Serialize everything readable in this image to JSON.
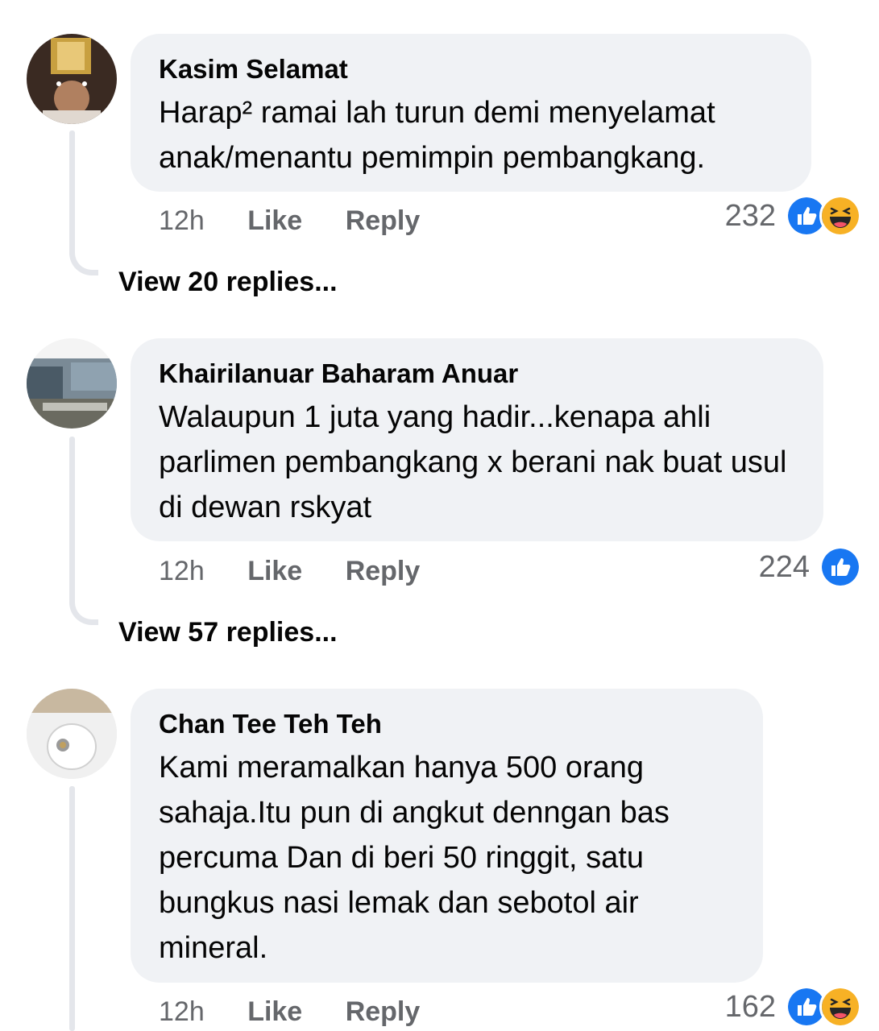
{
  "colors": {
    "bubble": "#f0f2f5",
    "meta_text": "#65676b",
    "like_blue": "#1877f2",
    "haha_yellow": "#f7b125",
    "thread_line": "#e4e6eb"
  },
  "comments": [
    {
      "author": "Kasim Selamat",
      "text": "Harap² ramai lah turun demi menyelamat anak/menantu pemimpin pembangkang.",
      "time": "12h",
      "like_label": "Like",
      "reply_label": "Reply",
      "reaction_count": "232",
      "reactions": [
        "like-icon",
        "haha-icon"
      ],
      "view_replies": "View 20 replies..."
    },
    {
      "author": "Khairilanuar Baharam Anuar",
      "text": "Walaupun 1 juta yang hadir...kenapa ahli parlimen pembangkang x berani nak buat usul di dewan rskyat",
      "time": "12h",
      "like_label": "Like",
      "reply_label": "Reply",
      "reaction_count": "224",
      "reactions": [
        "like-icon"
      ],
      "view_replies": "View 57 replies..."
    },
    {
      "author": "Chan Tee Teh Teh",
      "text": "Kami meramalkan hanya 500 orang sahaja.Itu pun di angkut denngan bas percuma Dan di beri 50 ringgit, satu bungkus nasi lemak dan sebotol air mineral.",
      "time": "12h",
      "like_label": "Like",
      "reply_label": "Reply",
      "reaction_count": "162",
      "reactions": [
        "like-icon",
        "haha-icon"
      ]
    }
  ]
}
